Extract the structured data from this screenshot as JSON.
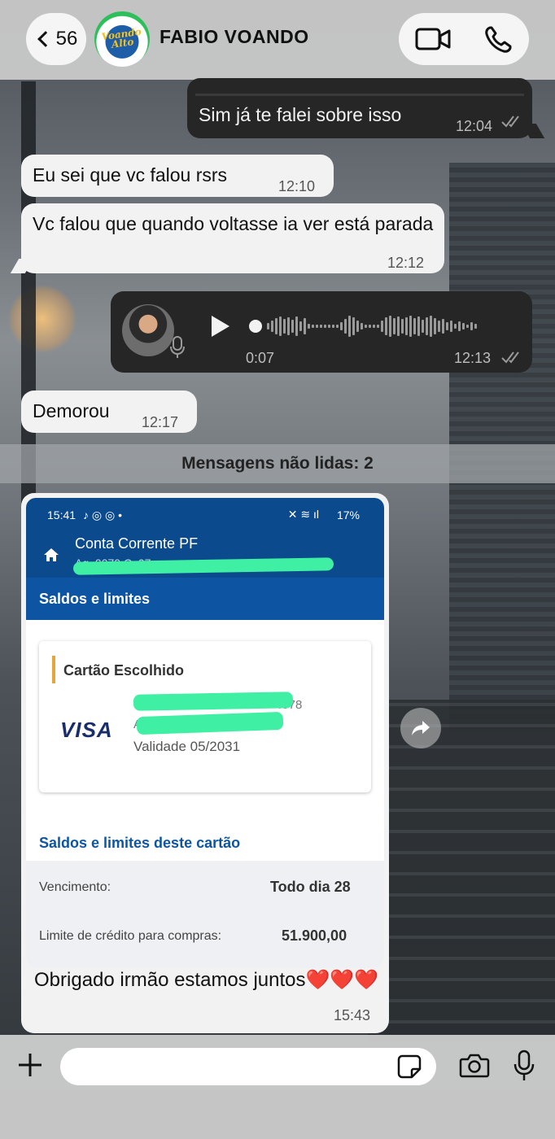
{
  "header": {
    "back_count": "56",
    "avatar_text": "Voando Alto",
    "contact_name": "FABIO VOANDO"
  },
  "messages": {
    "m1": {
      "text": "Sim já te falei sobre isso",
      "time": "12:04"
    },
    "m2": {
      "text": "Eu sei que vc falou rsrs",
      "time": "12:10"
    },
    "m3": {
      "text": "Vc falou que quando voltasse ia ver está parada",
      "time": "12:12"
    },
    "voice": {
      "duration": "0:07",
      "time": "12:13"
    },
    "m4": {
      "text": "Demorou",
      "time": "12:17"
    }
  },
  "unread_banner": "Mensagens não lidas: 2",
  "image_message": {
    "status_time": "15:41",
    "status_right": "17%",
    "account_title": "Conta Corrente PF",
    "account_number": "Ag. 0070 C. 07",
    "section_title": "Saldos e limites",
    "card_title": "Cartão Escolhido",
    "card_brand": "VISA",
    "card_line1": "4078",
    "card_line2": "A",
    "card_validity": "Validade 05/2031",
    "limits_title": "Saldos e limites deste cartão",
    "due_label": "Vencimento:",
    "due_value": "Todo dia 28",
    "limit_label": "Limite de crédito para compras:",
    "limit_value": "51.900,00",
    "caption": "Obrigado irmão estamos juntos❤️❤️❤️",
    "time": "15:43"
  },
  "composer": {
    "placeholder": ""
  }
}
